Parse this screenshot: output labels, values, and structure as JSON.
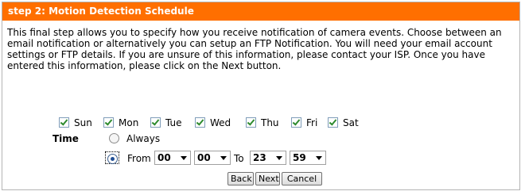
{
  "header": {
    "title": "step 2: Motion Detection Schedule"
  },
  "description": "This final step allows you to specify how you receive notification of camera events. Choose between an email notification or alternatively you can setup an FTP Notification. You will need your email account settings or FTP details. If you are unsure of this information, please contact your ISP. Once you have entered this information, please click on the Next button.",
  "days": [
    {
      "label": "Sun",
      "checked": true
    },
    {
      "label": "Mon",
      "checked": true
    },
    {
      "label": "Tue",
      "checked": true
    },
    {
      "label": "Wed",
      "checked": true
    },
    {
      "label": "Thu",
      "checked": true
    },
    {
      "label": "Fri",
      "checked": true
    },
    {
      "label": "Sat",
      "checked": true
    }
  ],
  "time": {
    "label": "Time",
    "always_label": "Always",
    "from_label": "From",
    "to_label": "To",
    "selected_option": "from",
    "from_hour": "00",
    "from_minute": "00",
    "to_hour": "23",
    "to_minute": "59"
  },
  "buttons": {
    "back": "Back",
    "next": "Next",
    "cancel": "Cancel"
  },
  "colors": {
    "header_bg": "#ff6f00",
    "header_text": "#ffffff"
  }
}
